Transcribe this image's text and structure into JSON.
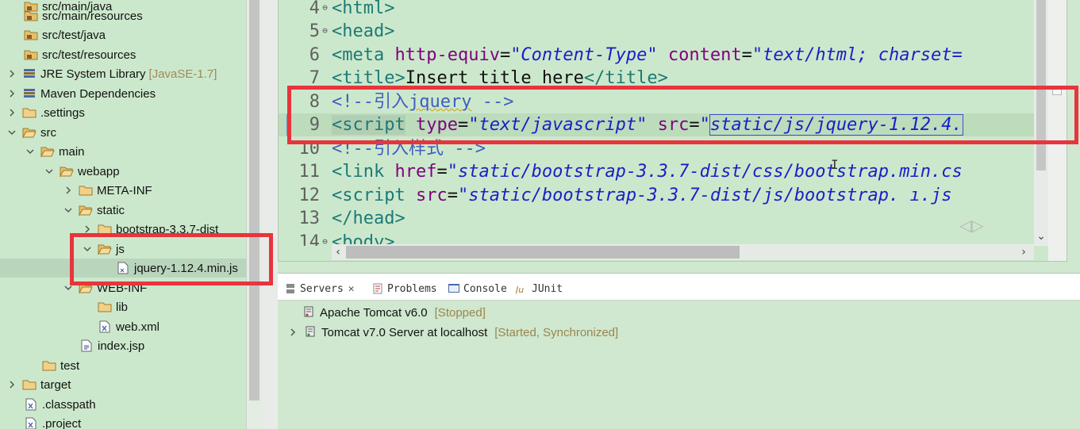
{
  "explorer": {
    "items": [
      {
        "label": "src/main/java"
      },
      {
        "label": "src/main/resources"
      },
      {
        "label": "src/test/java"
      },
      {
        "label": "src/test/resources"
      },
      {
        "label": "JRE System Library",
        "suffix": "[JavaSE-1.7]"
      },
      {
        "label": "Maven Dependencies"
      },
      {
        "label": ".settings"
      },
      {
        "label": "src"
      },
      {
        "label": "main"
      },
      {
        "label": "webapp"
      },
      {
        "label": "META-INF"
      },
      {
        "label": "static"
      },
      {
        "label": "bootstrap-3.3.7-dist"
      },
      {
        "label": "js"
      },
      {
        "label": "jquery-1.12.4.min.js"
      },
      {
        "label": "WEB-INF"
      },
      {
        "label": "lib"
      },
      {
        "label": "web.xml"
      },
      {
        "label": "index.jsp"
      },
      {
        "label": "test"
      },
      {
        "label": "target"
      },
      {
        "label": ".classpath"
      },
      {
        "label": ".project"
      }
    ]
  },
  "editor": {
    "lines": [
      {
        "num": "4",
        "t": [
          "<html>"
        ]
      },
      {
        "num": "5",
        "t": [
          "<head>"
        ]
      },
      {
        "num": "6",
        "t": [
          "<meta",
          "http-equiv",
          "=",
          "\"Content-Type\"",
          "content",
          "=",
          "\"text/html; charset="
        ]
      },
      {
        "num": "7",
        "t": [
          "<title>",
          "Insert title here",
          "</title>"
        ]
      },
      {
        "num": "8",
        "t": [
          "<!--引入",
          "jquery",
          "  -->"
        ]
      },
      {
        "num": "9",
        "t": [
          "<script",
          "type",
          "=",
          "\"text/javascript\"",
          "src",
          "=",
          "\"",
          "static/js/jquery-1.12.4."
        ]
      },
      {
        "num": "10",
        "t": [
          "<!--引入样式 -->"
        ]
      },
      {
        "num": "11",
        "t": [
          "<link",
          "href",
          "=",
          "\"static/bootstrap-3.3.7-dist/css/bootstrap.min.cs"
        ]
      },
      {
        "num": "12",
        "t": [
          "<script",
          "src",
          "=",
          "\"static/bootstrap-3.3.7-dist/js/bootstrap.  ı.js"
        ]
      },
      {
        "num": "13",
        "t": [
          "</head>"
        ]
      },
      {
        "num": "14",
        "t": [
          "<body>"
        ]
      }
    ]
  },
  "panel": {
    "tabs": [
      {
        "label": "Servers"
      },
      {
        "label": "Problems"
      },
      {
        "label": "Console"
      },
      {
        "label": "JUnit"
      }
    ],
    "servers": [
      {
        "name": "Apache Tomcat v6.0",
        "status": "[Stopped]"
      },
      {
        "name": "Tomcat v7.0 Server at localhost",
        "status": "[Started, Synchronized]"
      }
    ]
  },
  "colors": {
    "editor_background": "#cce8cc",
    "annotation_red": "#e8343c",
    "tag": "#1c7a76",
    "attribute": "#7f007f",
    "string": "#1a20c8",
    "comment": "#3f5fbf"
  }
}
